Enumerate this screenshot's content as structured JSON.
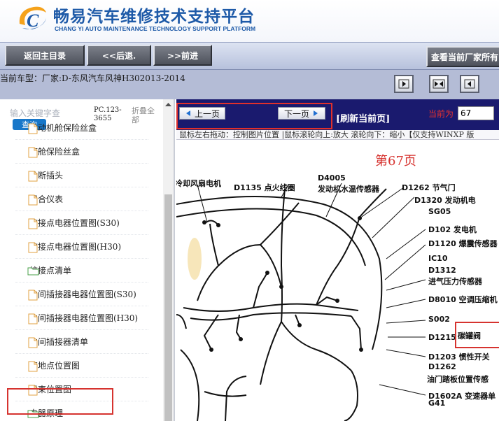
{
  "header": {
    "title_cn": "畅易汽车维修技术支持平台",
    "title_en": "CHANG YI AUTO MAINTENANCE TECHNOLOGY SUPPORT PLATFORM",
    "brand_color": "#1e5aa8"
  },
  "toolbar": {
    "home_label": "返回主目录",
    "back_label": "<<后退.",
    "forward_label": ">>前进",
    "vendor_label": "查看当前厂家所有"
  },
  "infobar": {
    "car_model": "当前车型：厂家:D-东风汽车风神H302013-2014"
  },
  "sidebar": {
    "search_placeholder": "输入关键字查",
    "query_label": "查询",
    "pc_code": "PC.123-3655",
    "collapse_label": "折叠全部",
    "items": [
      {
        "label": "发动机舱保险丝盒",
        "icon": "file-icon"
      },
      {
        "label": "座舱保险丝盒",
        "icon": "file-icon"
      },
      {
        "label": "诊断插头",
        "icon": "file-icon"
      },
      {
        "label": "组合仪表",
        "icon": "file-icon"
      },
      {
        "label": "绞接点电器位置图(S30)",
        "icon": "file-icon"
      },
      {
        "label": "绞接点电器位置图(H30)",
        "icon": "file-icon"
      },
      {
        "label": "绞接点清单",
        "icon": "folder-icon"
      },
      {
        "label": "中间插接器电器位置图(S30)",
        "icon": "file-icon"
      },
      {
        "label": "中间插接器电器位置图(H30)",
        "icon": "file-icon"
      },
      {
        "label": "中间插接器清单",
        "icon": "file-icon"
      },
      {
        "label": "接地点位置图",
        "icon": "file-icon"
      },
      {
        "label": "线束位置图",
        "icon": "file-icon"
      },
      {
        "label": "电器原理",
        "icon": "folder-icon"
      }
    ],
    "selected_item": "线束位置图"
  },
  "viewer": {
    "prev_label": "上一页",
    "next_label": "下一页",
    "refresh_label": "[刷新当前页]",
    "current_label": "当前为",
    "page_value": "67",
    "hint": "鼠标左右拖动：控制图片位置 |鼠标滚轮向上:放大  滚轮向下：缩小【仅支持WINXP 版",
    "page_heading": "第67页",
    "accent_color": "#d6332f"
  },
  "diagram": {
    "labels": [
      "冷却风扇电机",
      "D1135 点火线圈",
      "D4005",
      "发动机水温传感器",
      "D1262 节气门",
      "D1320 发动机电",
      "SG05",
      "D102 发电机",
      "D1120 爆震传感器",
      "IC10",
      "D1312",
      "进气压力传感器",
      "D8010 空调压缩机",
      "S002",
      "D1215",
      "碳罐阀",
      "D1203 惯性开关",
      "D1262",
      "油门踏板位置传感",
      "D1602A 变速器单",
      "G41"
    ]
  }
}
